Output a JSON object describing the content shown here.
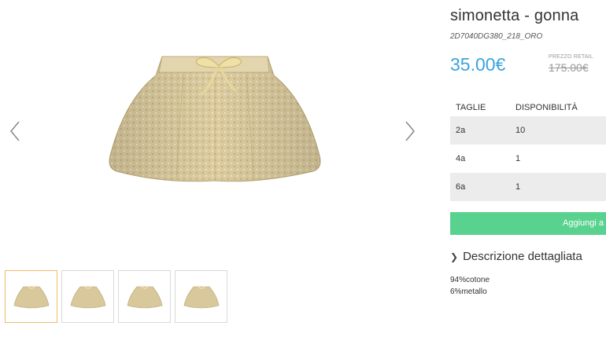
{
  "product": {
    "title": "simonetta - gonna",
    "sku": "2D7040DG380_218_ORO",
    "price": "35.00€",
    "retail_label": "PREZZO RETAIL",
    "retail_price": "175.00€"
  },
  "sizes_table": {
    "headers": [
      "TAGLIE",
      "DISPONIBILITÀ"
    ],
    "rows": [
      {
        "size": "2a",
        "availability": "10"
      },
      {
        "size": "4a",
        "availability": "1"
      },
      {
        "size": "6a",
        "availability": "1"
      }
    ]
  },
  "cart": {
    "add_label": "Aggiungi a"
  },
  "description": {
    "toggle_label": "Descrizione dettagliata",
    "lines": [
      "94%cotone",
      "6%metallo"
    ]
  },
  "gallery": {
    "thumbnail_count": 4,
    "active_thumbnail": 1
  },
  "colors": {
    "price": "#3aa4dc",
    "add_button": "#5ad28f",
    "active_thumb_border": "#f0b96a",
    "skirt_gold": "#d8c89c"
  },
  "icons": {
    "prev": "chevron-left-icon",
    "next": "chevron-right-icon",
    "toggle": "chevron-right-icon"
  }
}
